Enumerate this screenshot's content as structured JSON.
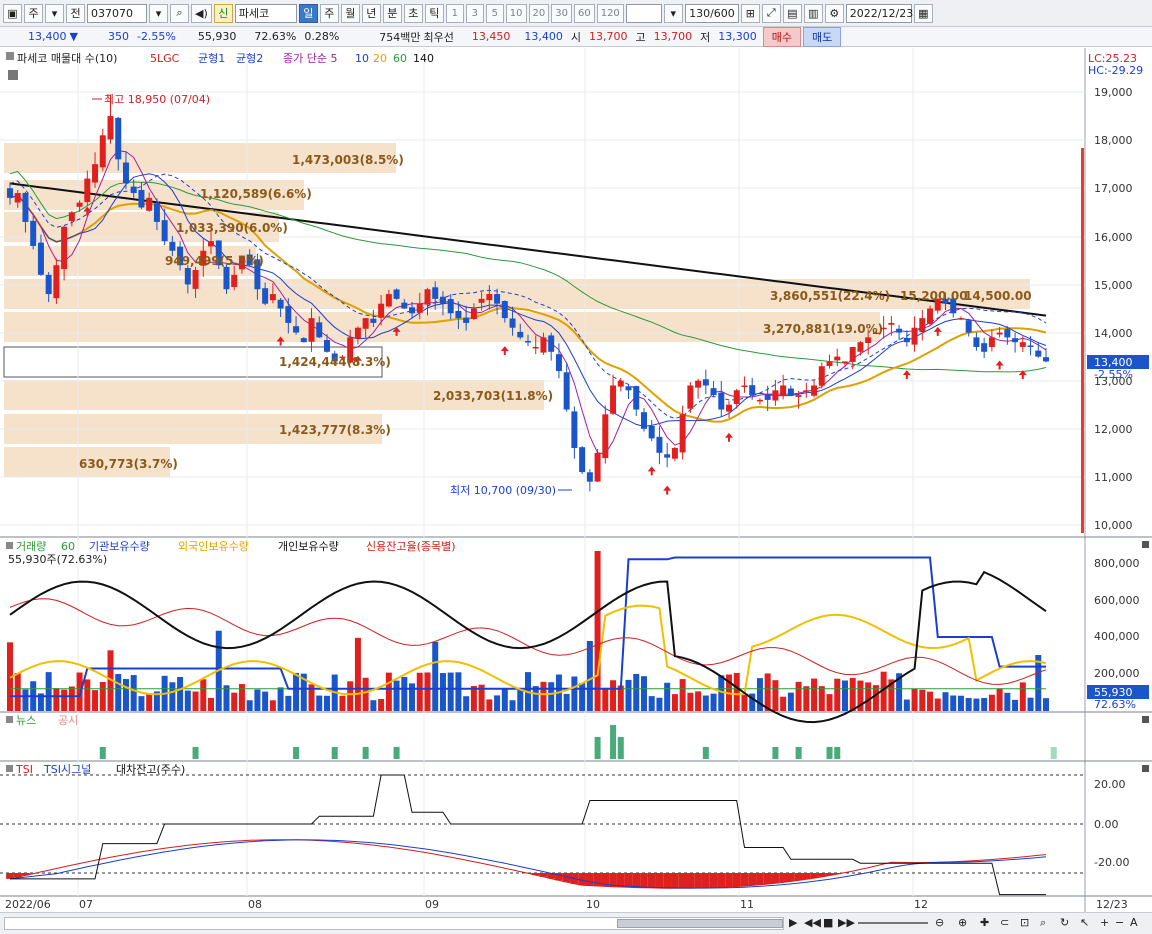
{
  "toolbar": {
    "period": "주",
    "prev": "전",
    "code": "037070",
    "badge": "신",
    "name": "파세코",
    "tabs": [
      "일",
      "주",
      "월",
      "년",
      "분",
      "초",
      "틱"
    ],
    "active_tab": "일",
    "nums": [
      "1",
      "3",
      "5",
      "10",
      "20",
      "30",
      "60",
      "120"
    ],
    "count": "130/600",
    "date": "2022/12/23"
  },
  "quote": {
    "price": "13,400",
    "arrow": "▼",
    "change": "350",
    "change_pct": "-2.55%",
    "volume": "55,930",
    "ratio": "72.63%",
    "turnover": "0.28%",
    "amount": "754백만",
    "best": "최우선",
    "best_ask": "13,450",
    "best_bid": "13,400",
    "open_label": "시",
    "open": "13,700",
    "high_label": "고",
    "high": "13,700",
    "low_label": "저",
    "low": "13,300",
    "buy": "매수",
    "sell": "매도"
  },
  "price_panel": {
    "legend": [
      "파세코 매물대 수(10)",
      "5LGC",
      "균형1",
      "균형2",
      "종가 단순 5",
      "10",
      "20",
      "60",
      "140"
    ],
    "lc": "LC:25.23",
    "hc": "HC:-29.29",
    "y_ticks": [
      "19,000",
      "18,000",
      "17,000",
      "16,000",
      "15,000",
      "14,000",
      "13,000",
      "12,000",
      "11,000",
      "10,000"
    ],
    "current_price_tag": "13,400",
    "current_pct_tag": "-2.55%",
    "high_note": "최고 18,950 (07/04)",
    "low_note": "최저 10,700 (09/30)",
    "volume_profile": [
      "1,473,003(8.5%)",
      "1,120,589(6.6%)",
      "1,033,390(6.0%)",
      "949,499(5.5%)",
      "3,860,551(22.4%)",
      "3,270,881(19.0%)",
      "1,424,444(8.3%)",
      "2,033,703(11.8%)",
      "1,423,777(8.3%)",
      "630,773(3.7%)"
    ],
    "price_labels": [
      "15,200.00",
      "14,500.00"
    ]
  },
  "volume_panel": {
    "legend": [
      "거래량",
      "60",
      "기관보유수량",
      "외국인보유수량",
      "개인보유수량",
      "신용잔고율(종목별)"
    ],
    "sub": "55,930주(72.63%)",
    "y_ticks": [
      "800,000",
      "600,000",
      "400,000",
      "200,000"
    ],
    "tag": "55,930",
    "tag_pct": "72.63%"
  },
  "news_panel": {
    "legend": [
      "뉴스",
      "공시"
    ]
  },
  "tsi_panel": {
    "legend": [
      "TSI",
      "TSI시그널",
      "대차잔고(주수)"
    ],
    "y_ticks": [
      "20.00",
      "0.00",
      "-20.00"
    ]
  },
  "x_axis": {
    "labels": [
      "2022/06",
      "07",
      "08",
      "09",
      "10",
      "11",
      "12"
    ],
    "last_date": "12/23"
  },
  "chart_data": {
    "type": "candlestick",
    "title": "파세코",
    "x_labels": [
      "2022/06",
      "07",
      "08",
      "09",
      "10",
      "11",
      "12"
    ],
    "ylim": [
      10000,
      19000
    ],
    "high": 18950,
    "low": 10700,
    "last": 13400,
    "closes": [
      16800,
      16900,
      16300,
      15800,
      15200,
      14800,
      15400,
      16200,
      16500,
      16700,
      17200,
      17500,
      18100,
      18500,
      17600,
      17100,
      16900,
      16600,
      16800,
      16300,
      15900,
      15700,
      15400,
      15000,
      15300,
      15700,
      15900,
      15400,
      14900,
      15200,
      15600,
      15400,
      14900,
      14600,
      14800,
      14500,
      14200,
      14000,
      13800,
      14300,
      13900,
      13600,
      13400,
      13500,
      13900,
      14100,
      14300,
      14200,
      14600,
      14800,
      14700,
      14500,
      14400,
      14600,
      14900,
      14700,
      14600,
      14400,
      14300,
      14200,
      14500,
      14700,
      14800,
      14600,
      14300,
      14100,
      13900,
      13800,
      13700,
      13900,
      13600,
      13200,
      12400,
      11600,
      11100,
      10900,
      11500,
      12300,
      12900,
      13000,
      12800,
      12400,
      12000,
      11800,
      11500,
      11400,
      11600,
      12300,
      12900,
      13000,
      12900,
      12700,
      12400,
      12500,
      12800,
      12900,
      12700,
      12600,
      12600,
      12800,
      12900,
      12700,
      12700,
      12800,
      12900,
      13300,
      13400,
      13500,
      13400,
      13700,
      13800,
      13900,
      14000,
      14100,
      14200,
      14000,
      13800,
      14100,
      14300,
      14500,
      14700,
      14600,
      14400,
      14300,
      14000,
      13700,
      13600,
      13900,
      14000,
      13900,
      13800,
      13800,
      13700,
      13500,
      13400
    ]
  }
}
